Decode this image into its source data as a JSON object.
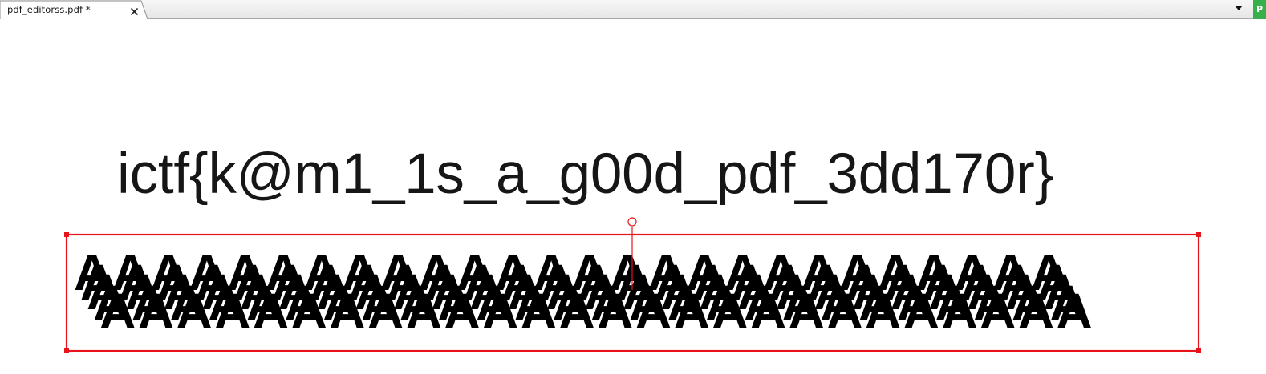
{
  "tabs": [
    {
      "label": "pdf_editorss.pdf *",
      "active": true
    }
  ],
  "side_badge": "P",
  "document": {
    "flag_text": "ictf{k@m1_1s_a_g00d_pdf_3dd170r}",
    "overlapping_text": "AAAAAAAAAAAAAAAAAAAAAAAAAA"
  },
  "colors": {
    "selection": "#e8141b",
    "badge": "#36b04a"
  },
  "icons": {
    "tab_close": "close-icon",
    "tab_list": "chevron-down-icon"
  }
}
